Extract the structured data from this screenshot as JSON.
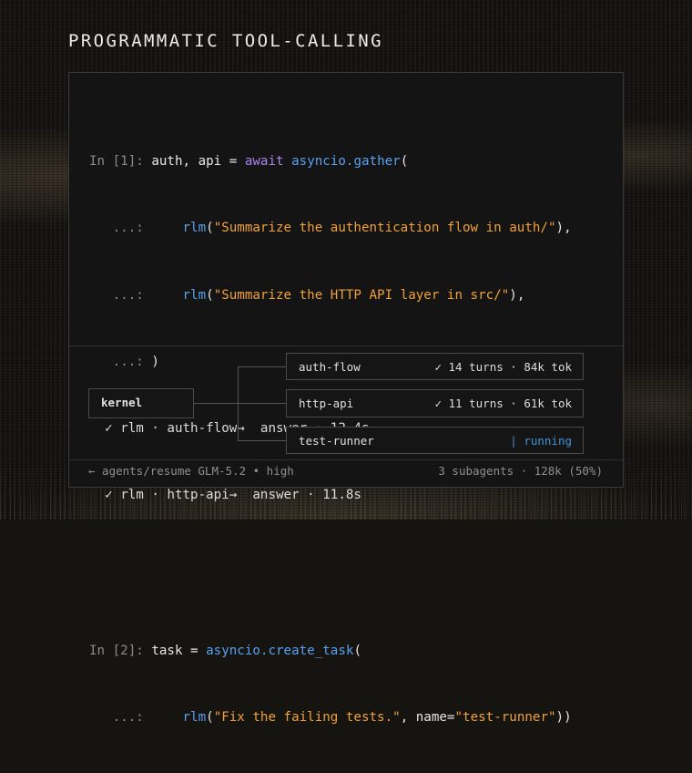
{
  "title": "PROGRAMMATIC TOOL-CALLING",
  "cells": [
    {
      "prompt": "In [1]:",
      "var": "auth, api",
      "op": " = ",
      "keyword": "await",
      "func": "asyncio.gather",
      "open": "(",
      "cont_prompt": "...:",
      "calls": [
        {
          "fn": "rlm",
          "arg": "\"Summarize the authentication flow in auth/\"",
          "tail": "),"
        },
        {
          "fn": "rlm",
          "arg": "\"Summarize the HTTP API layer in src/\"",
          "tail": "),"
        }
      ],
      "close": ")",
      "results": [
        {
          "check": "✓",
          "text": "rlm · auth-flow→  answer · 12.4s"
        },
        {
          "check": "✓",
          "text": "rlm · http-api→  answer · 11.8s"
        }
      ]
    },
    {
      "prompt": "In [2]:",
      "var": "task",
      "op": " = ",
      "func": "asyncio.create_task",
      "open": "(",
      "cont_prompt": "...:",
      "call_fn": "rlm",
      "call_arg": "\"Fix the failing tests.\"",
      "call_kw": ", name=",
      "call_kw_val": "\"test-runner\"",
      "call_tail": "))"
    }
  ],
  "graph": {
    "root": "kernel",
    "agents": [
      {
        "name": "auth-flow",
        "status": "✓ 14 turns · 84k tok",
        "state": "done"
      },
      {
        "name": "http-api",
        "status": "✓ 11 turns · 61k tok",
        "state": "done"
      },
      {
        "name": "test-runner",
        "status": "| running",
        "state": "running"
      }
    ]
  },
  "status_bar": {
    "left": "← agents/resume GLM-5.2 • high",
    "right": "3 subagents · 128k (50%)"
  },
  "colors": {
    "keyword": "#a983ef",
    "function": "#5aa0ee",
    "string": "#f0a13a",
    "running": "#3f92d8"
  }
}
